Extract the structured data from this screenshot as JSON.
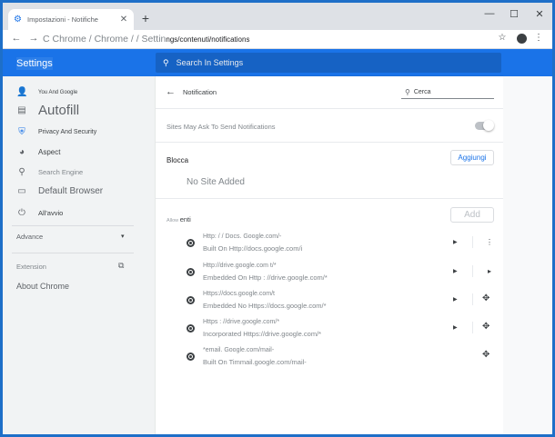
{
  "tab": {
    "title": "Impostazioni - Notifiche",
    "close": "✕"
  },
  "window_controls": {
    "minimize": "—",
    "maximize": "☐",
    "close": "✕"
  },
  "toolbar": {
    "scheme": "C Chrome / Chrome / / Settin",
    "path": "ngs/contenuti/notifications"
  },
  "header": {
    "title": "Settings",
    "search_placeholder": "Search In Settings"
  },
  "sidebar": {
    "items": [
      {
        "label": "You And Google",
        "icon": "person-icon"
      },
      {
        "label": "Autofill",
        "icon": "clipboard-icon"
      },
      {
        "label": "Privacy And Security",
        "icon": "shield-icon"
      },
      {
        "label": "Aspect",
        "icon": "palette-icon"
      },
      {
        "label": "Search Engine",
        "icon": "search-icon"
      },
      {
        "label": "Default Browser",
        "icon": "browser-icon"
      },
      {
        "label": "All'avvio",
        "icon": "power-icon"
      }
    ],
    "advanced": "Advance",
    "extensions": "Extension",
    "about": "About Chrome"
  },
  "notifications": {
    "title": "Notification",
    "search": "Cerca",
    "ask_label": "Sites May Ask To Send Notifications",
    "block_label": "Blocca",
    "add_button": "Aggiungi",
    "no_sites": "No Site Added",
    "allow_prefix": "Allow",
    "allow_label": "enti",
    "add_disabled": "Add"
  },
  "sites": [
    {
      "url": "Http: / / Docs. Google.com/-",
      "sub": "Built On Http://docs.google.com/i"
    },
    {
      "url": "Http://drive.google.com t/*",
      "sub": "Embedded On Http : //drive.google.com/*"
    },
    {
      "url": "Https://docs.google.com/t",
      "sub": "Embedded No Https://docs.google.com/*"
    },
    {
      "url": "Https : //drive.google.com/*",
      "sub": "Incorporated Https://drive.google.com/*"
    },
    {
      "url": "*email. Google.com/mail-",
      "sub": "Built On Timmail.google.com/mail-"
    }
  ]
}
